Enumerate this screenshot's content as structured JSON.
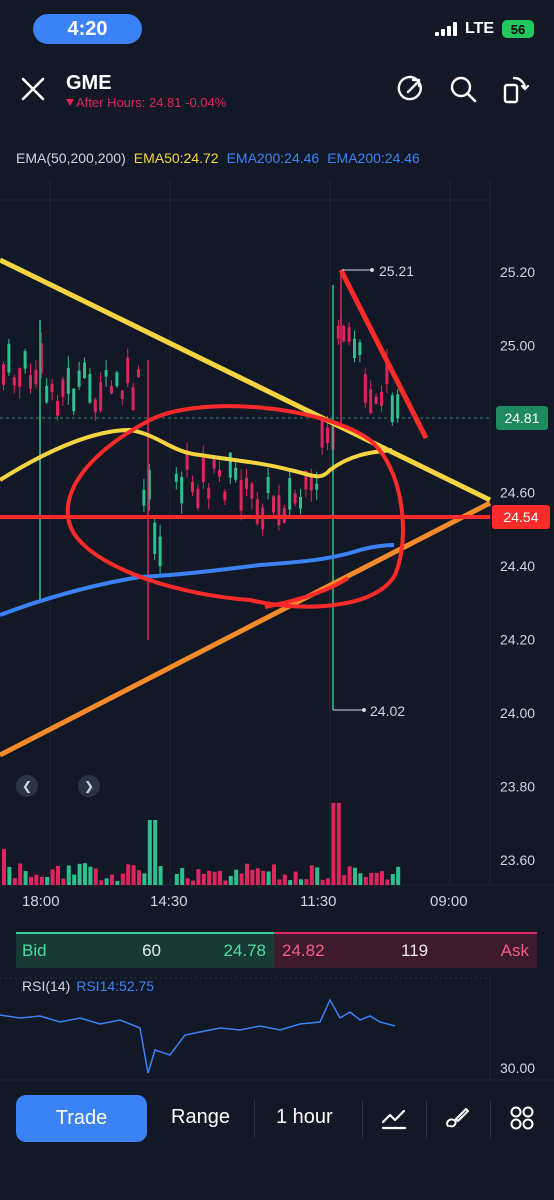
{
  "status_bar": {
    "time": "4:20",
    "network": "LTE",
    "battery": "56"
  },
  "header": {
    "ticker": "GME",
    "after_hours": "After Hours: 24.81 -0.04%"
  },
  "ema_legend": {
    "title": "EMA(50,200,200)",
    "ema50": "EMA50:24.72",
    "ema200a": "EMA200:24.46",
    "ema200b": "EMA200:24.46",
    "colors": {
      "ema50": "#f5d442",
      "ema200": "#3b82f6"
    }
  },
  "chart_data": {
    "type": "candlestick",
    "price_ticks": [
      "25.20",
      "25.00",
      "24.80",
      "24.60",
      "24.40",
      "24.20",
      "24.00",
      "23.80",
      "23.60"
    ],
    "time_ticks": [
      "18:00",
      "14:30",
      "11:30",
      "09:00"
    ],
    "current_price": "24.81",
    "level_price": "24.54",
    "high_annotation": "25.21",
    "low_annotation": "24.02",
    "colors": {
      "up": "#2fbf8f",
      "down": "#e0245e",
      "drawing_red": "#ff2a2a",
      "drawing_yellow": "#f5d442",
      "drawing_orange": "#f58a2a"
    }
  },
  "bid_ask": {
    "bid_label": "Bid",
    "bid_size": "60",
    "bid_price": "24.78",
    "ask_price": "24.82",
    "ask_size": "119",
    "ask_label": "Ask"
  },
  "rsi": {
    "title": "RSI(14)",
    "value": "RSI14:52.75",
    "tick": "30.00"
  },
  "toolbar": {
    "trade": "Trade",
    "range": "Range",
    "interval": "1 hour",
    "icons": [
      "chart-type-icon",
      "draw-icon",
      "grid-icon"
    ]
  }
}
